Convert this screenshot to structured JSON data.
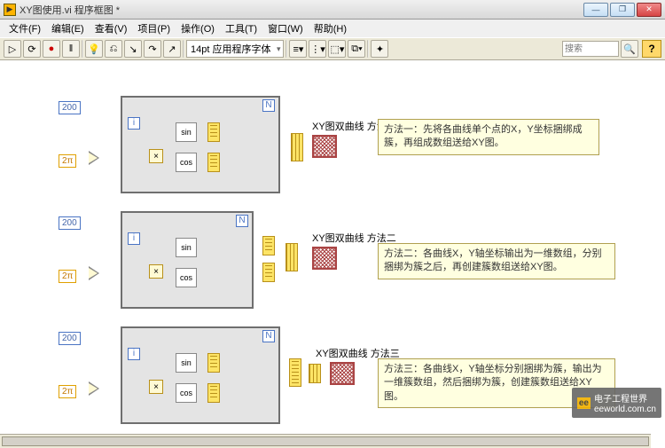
{
  "window": {
    "title": "XY图使用.vi 程序框图 *"
  },
  "menu": {
    "file": "文件(F)",
    "edit": "编辑(E)",
    "view": "查看(V)",
    "project": "项目(P)",
    "operate": "操作(O)",
    "tools": "工具(T)",
    "window": "窗口(W)",
    "help": "帮助(H)"
  },
  "toolbar": {
    "font": "14pt 应用程序字体",
    "search_placeholder": "搜索",
    "help_icon": "?"
  },
  "constants": {
    "count": "200",
    "twopi": "2π"
  },
  "loop": {
    "N": "N",
    "i": "i"
  },
  "funcs": {
    "div": "÷",
    "mult": "×",
    "sin": "sin",
    "cos": "cos"
  },
  "labels": {
    "m1": "XY图双曲线 方法一",
    "m2": "XY图双曲线 方法二",
    "m3": "XY图双曲线 方法三"
  },
  "comments": {
    "m1": "方法一：先将各曲线单个点的X，Y坐标捆绑成簇，再组成数组送给XY图。",
    "m2": "方法二：各曲线X，Y轴坐标输出为一维数组，分别捆绑为簇之后，再创建簇数组送给XY图。",
    "m3": "方法三：各曲线X，Y轴坐标分别捆绑为簇，输出为一维簇数组，然后捆绑为簇，创建簇数组送给XY图。"
  },
  "watermark": {
    "brand": "电子工程世界",
    "url": "eeworld.com.cn",
    "logo": "ee"
  }
}
